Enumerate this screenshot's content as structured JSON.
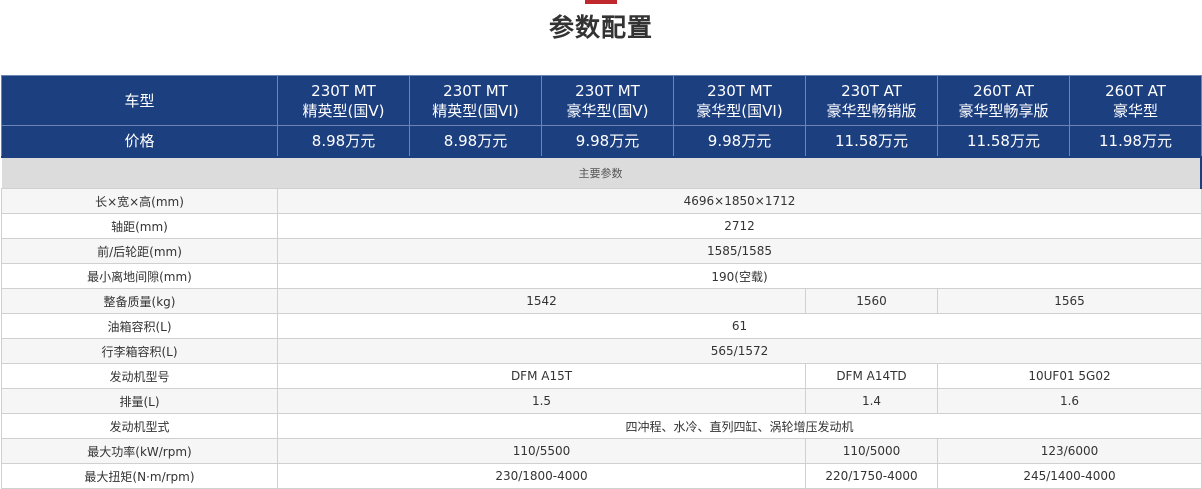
{
  "header": {
    "title": "参数配置"
  },
  "columns": [
    {
      "label_l1": "车型"
    },
    {
      "label_l1": "230T MT",
      "label_l2": "精英型(国V)"
    },
    {
      "label_l1": "230T MT",
      "label_l2": "精英型(国VI)"
    },
    {
      "label_l1": "230T MT",
      "label_l2": "豪华型(国V)"
    },
    {
      "label_l1": "230T MT",
      "label_l2": "豪华型(国VI)"
    },
    {
      "label_l1": "230T AT",
      "label_l2": "豪华型畅销版"
    },
    {
      "label_l1": "260T AT",
      "label_l2": "豪华型畅享版"
    },
    {
      "label_l1": "260T AT",
      "label_l2": "豪华型"
    }
  ],
  "price_row": {
    "label": "价格",
    "values": [
      "8.98万元",
      "8.98万元",
      "9.98万元",
      "9.98万元",
      "11.58万元",
      "11.58万元",
      "11.98万元"
    ]
  },
  "section": {
    "title": "主要参数"
  },
  "rows": [
    {
      "label": "长×宽×高(mm)",
      "cells": [
        {
          "text": "4696×1850×1712",
          "span": 7
        }
      ]
    },
    {
      "label": "轴距(mm)",
      "cells": [
        {
          "text": "2712",
          "span": 7
        }
      ]
    },
    {
      "label": "前/后轮距(mm)",
      "cells": [
        {
          "text": "1585/1585",
          "span": 7
        }
      ]
    },
    {
      "label": "最小离地间隙(mm)",
      "cells": [
        {
          "text": "190(空载)",
          "span": 7
        }
      ]
    },
    {
      "label": "整备质量(kg)",
      "cells": [
        {
          "text": "1542",
          "span": 4
        },
        {
          "text": "1560",
          "span": 1
        },
        {
          "text": "1565",
          "span": 2
        }
      ]
    },
    {
      "label": "油箱容积(L)",
      "cells": [
        {
          "text": "61",
          "span": 7
        }
      ]
    },
    {
      "label": "行李箱容积(L)",
      "cells": [
        {
          "text": "565/1572",
          "span": 7
        }
      ]
    },
    {
      "label": "发动机型号",
      "cells": [
        {
          "text": "DFM A15T",
          "span": 4
        },
        {
          "text": "DFM A14TD",
          "span": 1
        },
        {
          "text": "10UF01 5G02",
          "span": 2
        }
      ]
    },
    {
      "label": "排量(L)",
      "cells": [
        {
          "text": "1.5",
          "span": 4
        },
        {
          "text": "1.4",
          "span": 1
        },
        {
          "text": "1.6",
          "span": 2
        }
      ]
    },
    {
      "label": "发动机型式",
      "cells": [
        {
          "text": "四冲程、水冷、直列四缸、涡轮增压发动机",
          "span": 7
        }
      ]
    },
    {
      "label": "最大功率(kW/rpm)",
      "cells": [
        {
          "text": "110/5500",
          "span": 4
        },
        {
          "text": "110/5000",
          "span": 1
        },
        {
          "text": "123/6000",
          "span": 2
        }
      ]
    },
    {
      "label": "最大扭矩(N·m/rpm)",
      "cells": [
        {
          "text": "230/1800-4000",
          "span": 4
        },
        {
          "text": "220/1750-4000",
          "span": 1
        },
        {
          "text": "245/1400-4000",
          "span": 2
        }
      ]
    }
  ]
}
